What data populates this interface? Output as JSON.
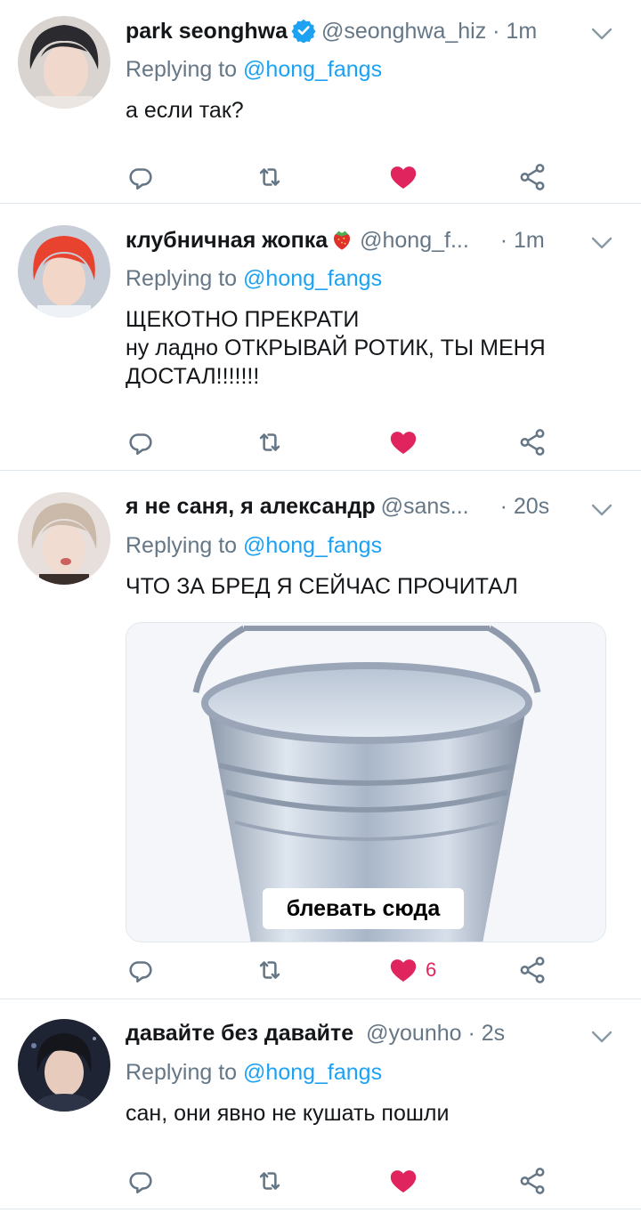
{
  "colors": {
    "accent": "#1da1f2",
    "secondary_text": "#657786",
    "like_red": "#e0245e",
    "icon_gray": "#657786",
    "divider": "#e1e8ed"
  },
  "tweets": [
    {
      "display_name": "park seonghwa",
      "verified": true,
      "handle": "@seonghwa_hiz",
      "timestamp": " · 1m",
      "replying_prefix": "Replying to ",
      "replying_to": "@hong_fangs",
      "lines": [
        "а если так?"
      ],
      "liked": true,
      "like_count": ""
    },
    {
      "display_name": "клубничная жопка",
      "emoji": "strawberry-icon",
      "handle": "@hong_f...",
      "timestamp": " · 1m",
      "replying_prefix": "Replying to ",
      "replying_to": "@hong_fangs",
      "lines": [
        "ЩЕКОТНО ПРЕКРАТИ",
        "ну ладно ОТКРЫВАЙ РОТИК, ТЫ МЕНЯ",
        "ДОСТАЛ!!!!!!!"
      ],
      "liked": true,
      "like_count": ""
    },
    {
      "display_name": "я не саня, я александр",
      "handle": "@sans...",
      "timestamp": " · 20s",
      "replying_prefix": "Replying to ",
      "replying_to": "@hong_fangs",
      "lines": [
        "ЧТО ЗА БРЕД Я СЕЙЧАС ПРОЧИТАЛ"
      ],
      "media_caption": "блевать сюда",
      "liked": true,
      "like_count": "6"
    },
    {
      "display_name": "давайте без давайте",
      "handle": "@younho",
      "timestamp": " · 2s",
      "replying_prefix": "Replying to ",
      "replying_to": "@hong_fangs",
      "lines": [
        "сан, они явно не кушать пошли"
      ],
      "liked": true,
      "like_count": ""
    }
  ]
}
